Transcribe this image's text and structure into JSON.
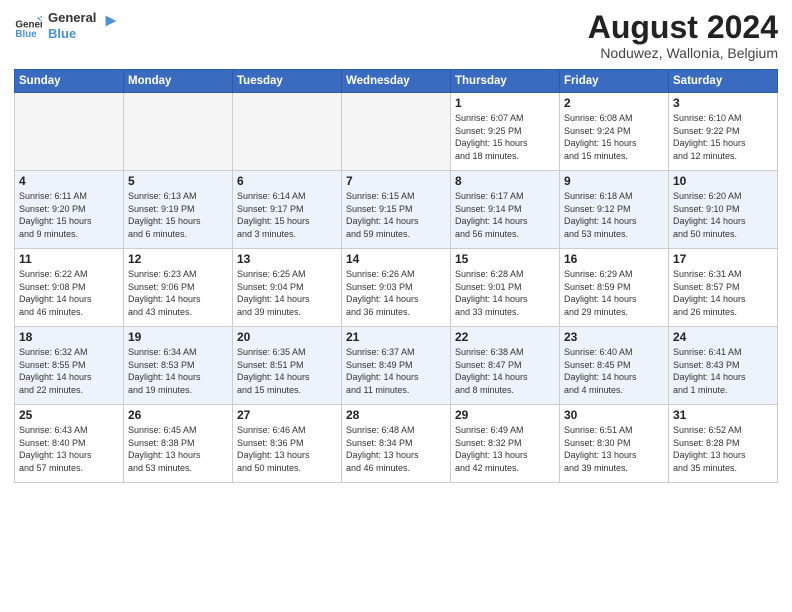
{
  "header": {
    "logo_general": "General",
    "logo_blue": "Blue",
    "month_year": "August 2024",
    "location": "Noduwez, Wallonia, Belgium"
  },
  "days_of_week": [
    "Sunday",
    "Monday",
    "Tuesday",
    "Wednesday",
    "Thursday",
    "Friday",
    "Saturday"
  ],
  "weeks": [
    [
      {
        "day": "",
        "info": ""
      },
      {
        "day": "",
        "info": ""
      },
      {
        "day": "",
        "info": ""
      },
      {
        "day": "",
        "info": ""
      },
      {
        "day": "1",
        "info": "Sunrise: 6:07 AM\nSunset: 9:25 PM\nDaylight: 15 hours\nand 18 minutes."
      },
      {
        "day": "2",
        "info": "Sunrise: 6:08 AM\nSunset: 9:24 PM\nDaylight: 15 hours\nand 15 minutes."
      },
      {
        "day": "3",
        "info": "Sunrise: 6:10 AM\nSunset: 9:22 PM\nDaylight: 15 hours\nand 12 minutes."
      }
    ],
    [
      {
        "day": "4",
        "info": "Sunrise: 6:11 AM\nSunset: 9:20 PM\nDaylight: 15 hours\nand 9 minutes."
      },
      {
        "day": "5",
        "info": "Sunrise: 6:13 AM\nSunset: 9:19 PM\nDaylight: 15 hours\nand 6 minutes."
      },
      {
        "day": "6",
        "info": "Sunrise: 6:14 AM\nSunset: 9:17 PM\nDaylight: 15 hours\nand 3 minutes."
      },
      {
        "day": "7",
        "info": "Sunrise: 6:15 AM\nSunset: 9:15 PM\nDaylight: 14 hours\nand 59 minutes."
      },
      {
        "day": "8",
        "info": "Sunrise: 6:17 AM\nSunset: 9:14 PM\nDaylight: 14 hours\nand 56 minutes."
      },
      {
        "day": "9",
        "info": "Sunrise: 6:18 AM\nSunset: 9:12 PM\nDaylight: 14 hours\nand 53 minutes."
      },
      {
        "day": "10",
        "info": "Sunrise: 6:20 AM\nSunset: 9:10 PM\nDaylight: 14 hours\nand 50 minutes."
      }
    ],
    [
      {
        "day": "11",
        "info": "Sunrise: 6:22 AM\nSunset: 9:08 PM\nDaylight: 14 hours\nand 46 minutes."
      },
      {
        "day": "12",
        "info": "Sunrise: 6:23 AM\nSunset: 9:06 PM\nDaylight: 14 hours\nand 43 minutes."
      },
      {
        "day": "13",
        "info": "Sunrise: 6:25 AM\nSunset: 9:04 PM\nDaylight: 14 hours\nand 39 minutes."
      },
      {
        "day": "14",
        "info": "Sunrise: 6:26 AM\nSunset: 9:03 PM\nDaylight: 14 hours\nand 36 minutes."
      },
      {
        "day": "15",
        "info": "Sunrise: 6:28 AM\nSunset: 9:01 PM\nDaylight: 14 hours\nand 33 minutes."
      },
      {
        "day": "16",
        "info": "Sunrise: 6:29 AM\nSunset: 8:59 PM\nDaylight: 14 hours\nand 29 minutes."
      },
      {
        "day": "17",
        "info": "Sunrise: 6:31 AM\nSunset: 8:57 PM\nDaylight: 14 hours\nand 26 minutes."
      }
    ],
    [
      {
        "day": "18",
        "info": "Sunrise: 6:32 AM\nSunset: 8:55 PM\nDaylight: 14 hours\nand 22 minutes."
      },
      {
        "day": "19",
        "info": "Sunrise: 6:34 AM\nSunset: 8:53 PM\nDaylight: 14 hours\nand 19 minutes."
      },
      {
        "day": "20",
        "info": "Sunrise: 6:35 AM\nSunset: 8:51 PM\nDaylight: 14 hours\nand 15 minutes."
      },
      {
        "day": "21",
        "info": "Sunrise: 6:37 AM\nSunset: 8:49 PM\nDaylight: 14 hours\nand 11 minutes."
      },
      {
        "day": "22",
        "info": "Sunrise: 6:38 AM\nSunset: 8:47 PM\nDaylight: 14 hours\nand 8 minutes."
      },
      {
        "day": "23",
        "info": "Sunrise: 6:40 AM\nSunset: 8:45 PM\nDaylight: 14 hours\nand 4 minutes."
      },
      {
        "day": "24",
        "info": "Sunrise: 6:41 AM\nSunset: 8:43 PM\nDaylight: 14 hours\nand 1 minute."
      }
    ],
    [
      {
        "day": "25",
        "info": "Sunrise: 6:43 AM\nSunset: 8:40 PM\nDaylight: 13 hours\nand 57 minutes."
      },
      {
        "day": "26",
        "info": "Sunrise: 6:45 AM\nSunset: 8:38 PM\nDaylight: 13 hours\nand 53 minutes."
      },
      {
        "day": "27",
        "info": "Sunrise: 6:46 AM\nSunset: 8:36 PM\nDaylight: 13 hours\nand 50 minutes."
      },
      {
        "day": "28",
        "info": "Sunrise: 6:48 AM\nSunset: 8:34 PM\nDaylight: 13 hours\nand 46 minutes."
      },
      {
        "day": "29",
        "info": "Sunrise: 6:49 AM\nSunset: 8:32 PM\nDaylight: 13 hours\nand 42 minutes."
      },
      {
        "day": "30",
        "info": "Sunrise: 6:51 AM\nSunset: 8:30 PM\nDaylight: 13 hours\nand 39 minutes."
      },
      {
        "day": "31",
        "info": "Sunrise: 6:52 AM\nSunset: 8:28 PM\nDaylight: 13 hours\nand 35 minutes."
      }
    ]
  ]
}
